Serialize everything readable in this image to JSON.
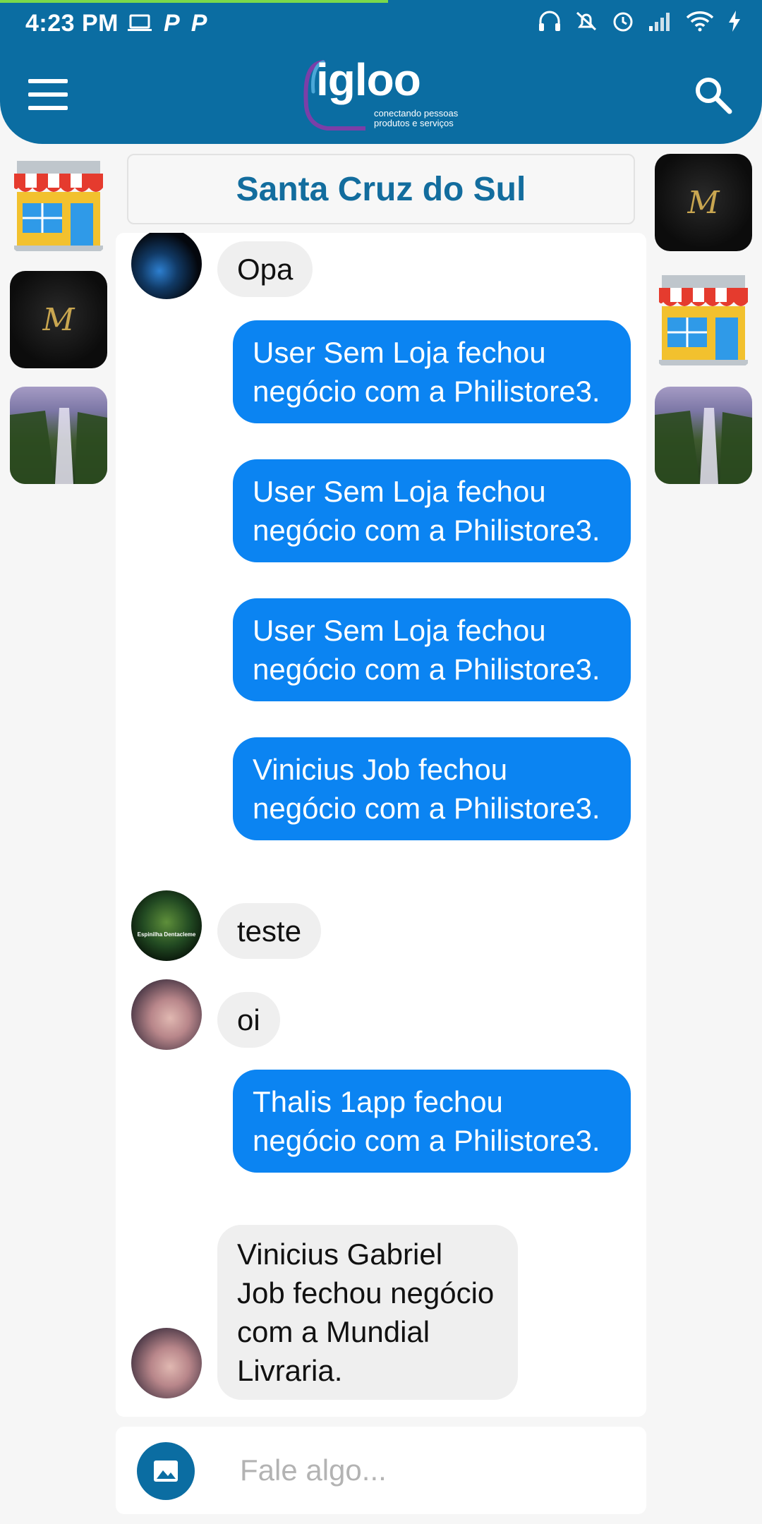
{
  "status_bar": {
    "time": "4:23 PM",
    "icons": [
      "laptop-icon",
      "parking-icon",
      "parking-icon",
      "headphones-icon",
      "bell-off-icon",
      "alarm-icon",
      "signal-icon",
      "wifi-icon",
      "charging-icon"
    ]
  },
  "app_bar": {
    "logo_text": "igloo",
    "tagline_line1": "conectando pessoas",
    "tagline_line2": "produtos e serviços",
    "menu_icon": "hamburger-menu-icon",
    "search_icon": "search-icon",
    "colors": {
      "bar": "#0b6da2",
      "progress": "#7ad94b"
    }
  },
  "city_header": {
    "title": "Santa Cruz do Sul",
    "color": "#136d9e"
  },
  "left_thumbnails": [
    "store-icon",
    "monogram-logo",
    "waterfall-photo"
  ],
  "right_thumbnails": [
    "monogram-logo",
    "store-icon",
    "waterfall-photo"
  ],
  "messages": [
    {
      "direction": "incoming",
      "avatar": "blue-light-avatar",
      "text": "Opa"
    },
    {
      "direction": "outgoing",
      "text": "User Sem Loja fechou negócio com a Philistore3."
    },
    {
      "direction": "outgoing",
      "text": "User Sem Loja fechou negócio com a Philistore3."
    },
    {
      "direction": "outgoing",
      "text": "User Sem Loja fechou negócio com a Philistore3."
    },
    {
      "direction": "outgoing",
      "text": "Vinicius Job fechou negócio com a Philistore3."
    },
    {
      "direction": "incoming",
      "avatar": "bird-avatar",
      "avatar_caption": "Espinilha Dentacleme",
      "text": "teste"
    },
    {
      "direction": "incoming",
      "avatar": "user-photo-avatar",
      "text": "oi"
    },
    {
      "direction": "outgoing",
      "text": "Thalis 1app fechou negócio com a Philistore3."
    },
    {
      "direction": "incoming",
      "avatar": "user-photo-avatar",
      "text": "Vinicius Gabriel Job fechou negócio com a Mundial Livraria."
    }
  ],
  "colors": {
    "outgoing_bubble": "#0b84f2",
    "incoming_bubble": "#efefef"
  },
  "composer": {
    "placeholder": "Fale algo...",
    "photo_icon": "image-icon"
  }
}
